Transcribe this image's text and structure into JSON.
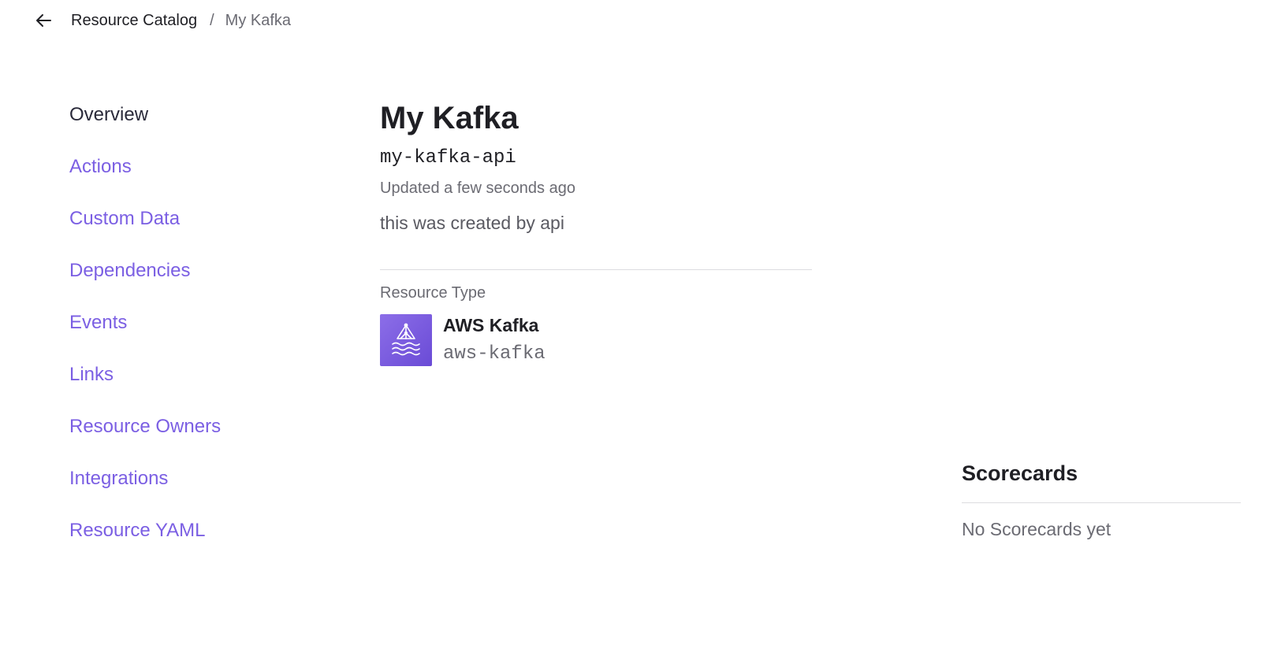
{
  "breadcrumb": {
    "back_icon": "arrow-left-icon",
    "parent_label": "Resource Catalog",
    "separator": "/",
    "current_label": "My Kafka"
  },
  "nav": {
    "items": [
      {
        "label": "Overview",
        "active": true
      },
      {
        "label": "Actions"
      },
      {
        "label": "Custom Data"
      },
      {
        "label": "Dependencies"
      },
      {
        "label": "Events"
      },
      {
        "label": "Links"
      },
      {
        "label": "Resource Owners"
      },
      {
        "label": "Integrations"
      },
      {
        "label": "Resource YAML"
      }
    ]
  },
  "resource": {
    "title": "My Kafka",
    "tag": "my-kafka-api",
    "updated": "Updated a few seconds ago",
    "description": "this was created by api"
  },
  "resource_type": {
    "label": "Resource Type",
    "name": "AWS Kafka",
    "tag": "aws-kafka",
    "icon": "aws-kafka-icon"
  },
  "scorecards": {
    "title": "Scorecards",
    "empty_text": "No Scorecards yet"
  },
  "colors": {
    "accent": "#7b5fe3",
    "text": "#1f1f24",
    "muted": "#6b6b73",
    "icon_bg": "#7a5ae0",
    "divider": "#dcdce0"
  }
}
